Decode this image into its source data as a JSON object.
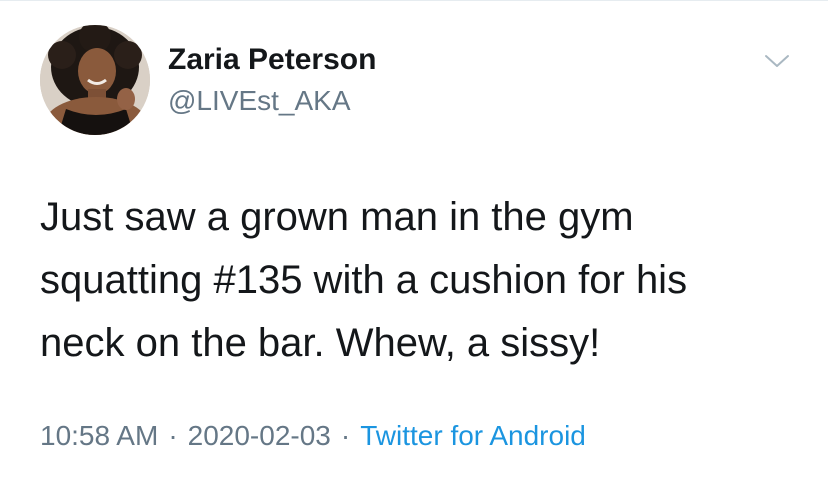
{
  "tweet": {
    "author": {
      "display_name": "Zaria Peterson",
      "handle": "@LIVEst_AKA",
      "avatar_icon": "profile-photo"
    },
    "menu_icon": "chevron-down-icon",
    "text_lines": [
      "Just saw a grown man in the gym",
      "squatting #135 with a cushion for his",
      "neck on the bar. Whew, a sissy!"
    ],
    "time": "10:58 AM",
    "separator": "·",
    "date": "2020-02-03",
    "source": "Twitter for Android"
  },
  "colors": {
    "text": "#14171a",
    "secondary": "#657786",
    "link": "#1b95e0",
    "divider": "#e6ecf0"
  }
}
